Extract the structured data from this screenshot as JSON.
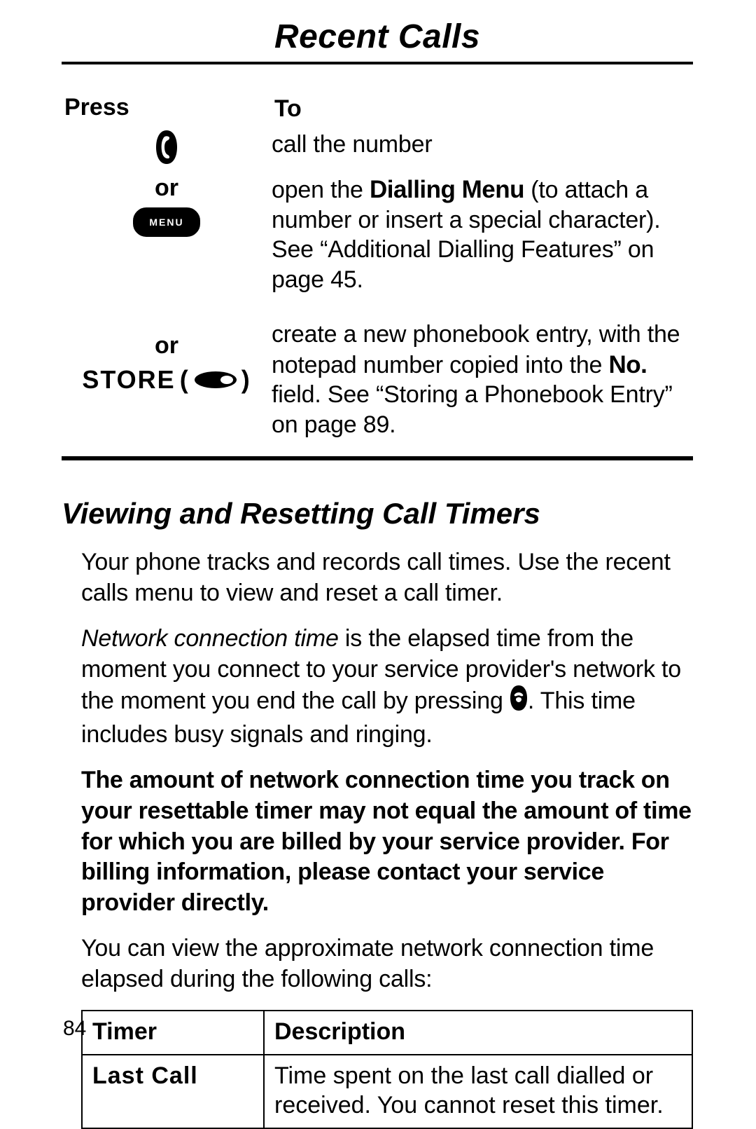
{
  "chapter_title": "Recent Calls",
  "press_to": {
    "press_header": "Press",
    "to_header": "To",
    "row1_desc": "call the number",
    "row2_or": "or",
    "row2_menu": "MENU",
    "row2_a": "open the ",
    "row2_b": "Dialling Menu",
    "row2_c": " (to attach a number or insert a special character). See “Additional Dialling Features” on page 45.",
    "row3_or": "or",
    "row3_store": "STORE",
    "row3_a": "create a new phonebook entry, with the notepad number copied into the ",
    "row3_b": "No.",
    "row3_c": " field. See “Storing a Phonebook Entry” on page 89."
  },
  "section_heading": "Viewing and Resetting Call Timers",
  "para1": "Your phone tracks and records call times. Use the recent calls menu to view and reset a call timer.",
  "para2_a": "Network connection time",
  "para2_b": " is the elapsed time from the moment you connect to your service provider's network to the moment you end the call by pressing ",
  "para2_c": ". This time includes busy signals and ringing.",
  "para3": "The amount of network connection time you track on your resettable timer may not equal the amount of time for which you are billed by your service provider. For billing information, please contact your service provider directly.",
  "para4": "You can view the approximate network connection time elapsed during the following calls:",
  "timer_table": {
    "header_timer": "Timer",
    "header_desc": "Description",
    "row1_timer": "Last Call",
    "row1_desc": "Time spent on the last call dialled or received. You cannot reset this timer."
  },
  "page_number": "84"
}
